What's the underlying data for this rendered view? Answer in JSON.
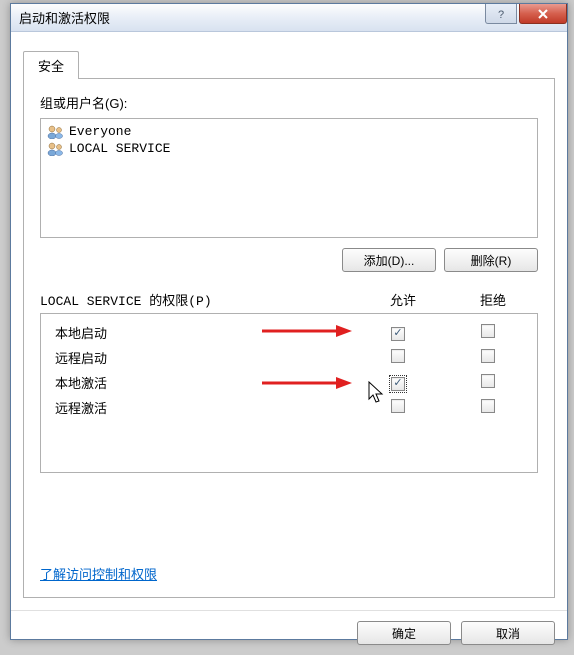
{
  "window": {
    "title": "启动和激活权限"
  },
  "tab": {
    "label": "安全"
  },
  "groups": {
    "label": "组或用户名(G):",
    "items": [
      {
        "name": "Everyone",
        "icon": "users-icon"
      },
      {
        "name": "LOCAL SERVICE",
        "icon": "users-icon"
      }
    ]
  },
  "buttons": {
    "add": "添加(D)...",
    "remove": "删除(R)",
    "ok": "确定",
    "cancel": "取消"
  },
  "permissions": {
    "header_label": "LOCAL SERVICE 的权限(P)",
    "allow_col": "允许",
    "deny_col": "拒绝",
    "rows": [
      {
        "label": "本地启动",
        "allow": true,
        "deny": false
      },
      {
        "label": "远程启动",
        "allow": false,
        "deny": false
      },
      {
        "label": "本地激活",
        "allow": true,
        "deny": false
      },
      {
        "label": "远程激活",
        "allow": false,
        "deny": false
      }
    ]
  },
  "link": {
    "text": "了解访问控制和权限"
  }
}
